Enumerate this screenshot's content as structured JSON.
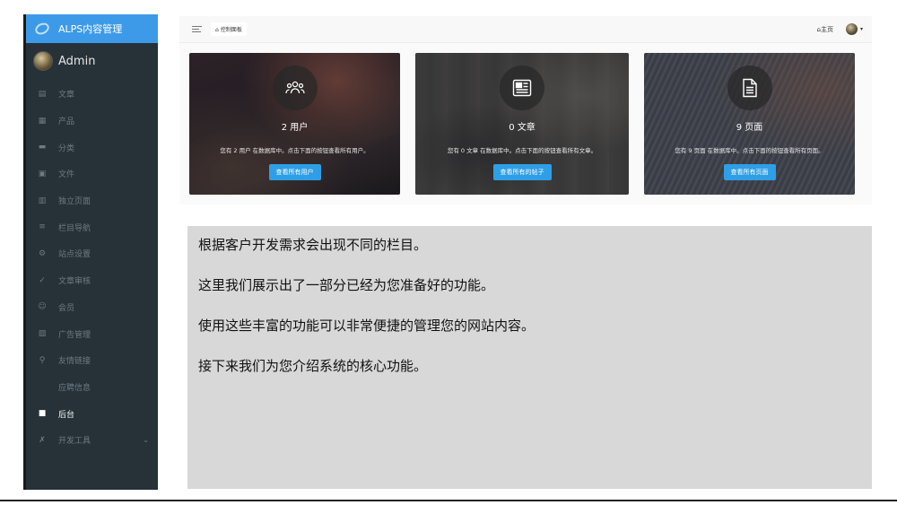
{
  "brand": {
    "title": "ALPS内容管理"
  },
  "user": {
    "name": "Admin"
  },
  "menu": [
    {
      "label": "文章",
      "icon": "document-icon",
      "glyph": "▤"
    },
    {
      "label": "产品",
      "icon": "product-icon",
      "glyph": "▦"
    },
    {
      "label": "分类",
      "icon": "folder-icon",
      "glyph": "▬"
    },
    {
      "label": "文件",
      "icon": "file-icon",
      "glyph": "▣"
    },
    {
      "label": "独立页面",
      "icon": "page-icon",
      "glyph": "▥"
    },
    {
      "label": "栏目导航",
      "icon": "list-icon",
      "glyph": "≡"
    },
    {
      "label": "站点设置",
      "icon": "gear-icon",
      "glyph": "⚙"
    },
    {
      "label": "文章审核",
      "icon": "check-icon",
      "glyph": "✓"
    },
    {
      "label": "会员",
      "icon": "smile-icon",
      "glyph": "☺"
    },
    {
      "label": "广告管理",
      "icon": "image-icon",
      "glyph": "▧"
    },
    {
      "label": "友情链接",
      "icon": "link-icon",
      "glyph": "⚲"
    },
    {
      "label": "应聘信息",
      "icon": "",
      "glyph": ""
    },
    {
      "label": "后台",
      "icon": "briefcase-icon",
      "glyph": "■"
    },
    {
      "label": "开发工具",
      "icon": "tools-icon",
      "glyph": "✗"
    }
  ],
  "topbar": {
    "breadcrumb": "控制面板",
    "home": "主页"
  },
  "cards": [
    {
      "title": "2 用户",
      "desc": "您有 2 用户 在数据库中。点击下面的按钮查看所有用户。",
      "button": "查看所有用户",
      "icon": "users-icon"
    },
    {
      "title": "0 文章",
      "desc": "您有 0 文章 在数据库中。点击下面的按钮查看所有文章。",
      "button": "查看所有的帖子",
      "icon": "newspaper-icon"
    },
    {
      "title": "9 页面",
      "desc": "您有 9 页面 在数据库中。点击下面的按钮查看所有页面。",
      "button": "查看所有页面",
      "icon": "page-icon"
    }
  ],
  "panel": {
    "lines": [
      "根据客户开发需求会出现不同的栏目。",
      "这里我们展示出了一部分已经为您准备好的功能。",
      "使用这些丰富的功能可以非常便捷的管理您的网站内容。",
      "接下来我们为您介绍系统的核心功能。"
    ]
  },
  "colors": {
    "sidebar": "#263238",
    "brand": "#3d9ae8",
    "button": "#2e9fe6",
    "panel": "#d8d8d8"
  }
}
